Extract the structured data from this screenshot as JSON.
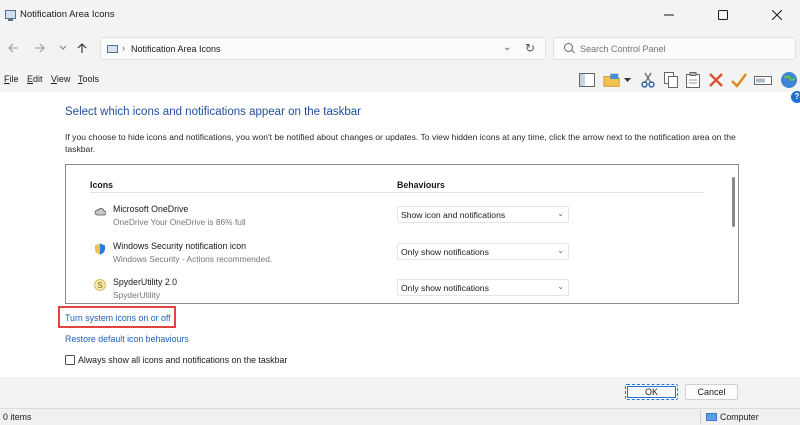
{
  "window": {
    "title": "Notification Area Icons"
  },
  "address": {
    "path": "Notification Area Icons"
  },
  "search": {
    "placeholder": "Search Control Panel"
  },
  "menu": {
    "file": "ile",
    "file_key": "F",
    "edit": "dit",
    "edit_key": "E",
    "view": "iew",
    "view_key": "V",
    "tools": "ools",
    "tools_key": "T"
  },
  "toolbar_icons": [
    "pane-icon",
    "properties-icon",
    "cut-icon",
    "copy-icon",
    "paste-icon",
    "delete-icon",
    "check-icon",
    "rename-icon",
    "globe-icon"
  ],
  "main": {
    "heading": "Select which icons and notifications appear on the taskbar",
    "description": "If you choose to hide icons and notifications, you won't be notified about changes or updates. To view hidden icons at any time, click the arrow next to the notification area on the taskbar.",
    "columns": {
      "icons": "Icons",
      "behaviours": "Behaviours"
    },
    "rows": [
      {
        "name": "Microsoft OneDrive",
        "sub": "OneDrive Your OneDrive is 86% full",
        "behaviour": "Show icon and notifications",
        "icon": "cloud-icon"
      },
      {
        "name": "Windows Security notification icon",
        "sub": "Windows Security - Actions recommended.",
        "behaviour": "Only show notifications",
        "icon": "shield-icon"
      },
      {
        "name": "SpyderUtility 2.0",
        "sub": "SpyderUtility",
        "behaviour": "Only show notifications",
        "icon": "spyder-icon"
      }
    ],
    "link_system_icons": "Turn system icons on or off",
    "link_restore": "Restore default icon behaviours",
    "checkbox_label": "Always show all icons and notifications on the taskbar"
  },
  "buttons": {
    "ok": "OK",
    "cancel": "Cancel"
  },
  "status": {
    "count": "0 items",
    "location": "Computer"
  },
  "colors": {
    "heading": "#1f4e9c",
    "link": "#1f5eb8",
    "highlight": "#e0443e"
  }
}
